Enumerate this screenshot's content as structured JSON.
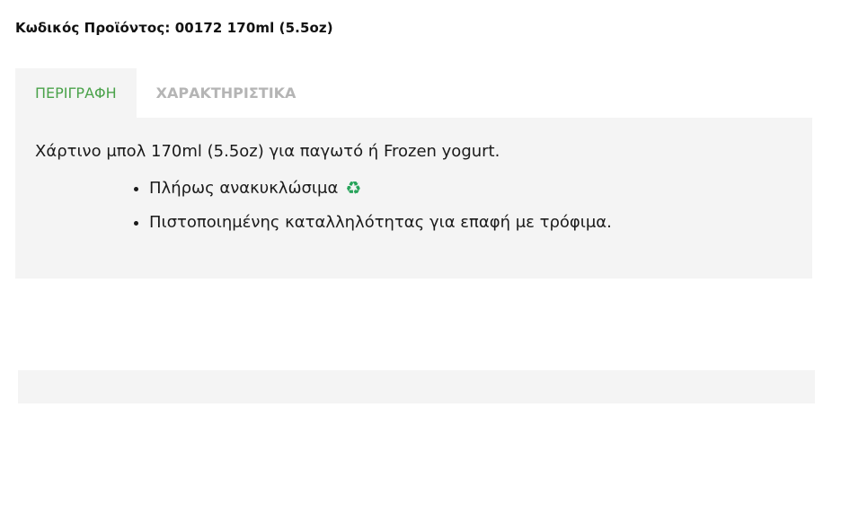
{
  "product": {
    "code_line": "Κωδικός Προϊόντος: 00172 170ml (5.5oz)"
  },
  "tabs": [
    {
      "label": "ΠΕΡΙΓΡΑΦΗ",
      "active": true
    },
    {
      "label": "ΧΑΡΑΚΤΗΡΙΣΤΙΚΑ",
      "active": false
    }
  ],
  "description": {
    "text": "Χάρτινο μπολ 170ml (5.5oz) για παγωτό ή Frozen yogurt.",
    "features": [
      {
        "text": "Πλήρως ανακυκλώσιμα",
        "icon": "recycle-icon"
      },
      {
        "text": "Πιστοποιημένης καταλληλότητας για επαφή με τρόφιμα."
      }
    ]
  },
  "colors": {
    "active_tab_text": "#4aa24a",
    "inactive_tab_text": "#b5b5b5",
    "panel_background": "#f4f4f4",
    "recycle_icon": "#27a35a"
  }
}
